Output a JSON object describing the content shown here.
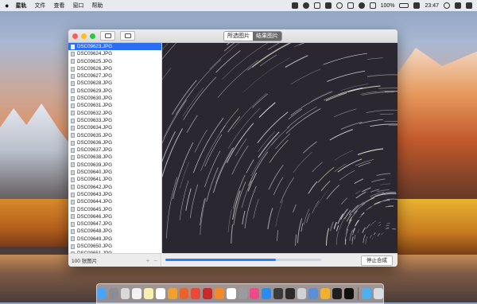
{
  "menubar": {
    "apple": "",
    "items": [
      "星轨",
      "文件",
      "查看",
      "窗口",
      "帮助"
    ],
    "battery": "100%",
    "time": "23:47"
  },
  "toolbar": {
    "seg_selected": "所选图片",
    "seg_result": "结果图片"
  },
  "files": [
    "DSC09623.JPG",
    "DSC09624.JPG",
    "DSC09625.JPG",
    "DSC09626.JPG",
    "DSC09627.JPG",
    "DSC09628.JPG",
    "DSC09629.JPG",
    "DSC09630.JPG",
    "DSC09631.JPG",
    "DSC09632.JPG",
    "DSC09633.JPG",
    "DSC09634.JPG",
    "DSC09635.JPG",
    "DSC09636.JPG",
    "DSC09637.JPG",
    "DSC09638.JPG",
    "DSC09639.JPG",
    "DSC09640.JPG",
    "DSC09641.JPG",
    "DSC09642.JPG",
    "DSC09643.JPG",
    "DSC09644.JPG",
    "DSC09645.JPG",
    "DSC09646.JPG",
    "DSC09647.JPG",
    "DSC09648.JPG",
    "DSC09649.JPG",
    "DSC09650.JPG",
    "DSC09651.JPG",
    "DSC09652.JPG"
  ],
  "selected_file_index": 0,
  "footer": {
    "count_label": "100 张图片",
    "add": "+",
    "remove": "−",
    "stop_button": "停止合成"
  },
  "progress": 0.71,
  "colors": {
    "accent": "#2a6ef5",
    "progress": "#2f7df6",
    "preview_bg": "#2b2730"
  },
  "dock_apps": [
    {
      "name": "finder-icon",
      "color": "#4ba3f5"
    },
    {
      "name": "launchpad-icon",
      "color": "#8c8c94"
    },
    {
      "name": "safari-icon",
      "color": "#d9d9d9"
    },
    {
      "name": "photos-icon",
      "color": "#f2f2f2"
    },
    {
      "name": "notes-icon",
      "color": "#f7f0b0"
    },
    {
      "name": "reminders-icon",
      "color": "#ffffff"
    },
    {
      "name": "pages-icon",
      "color": "#f0a030"
    },
    {
      "name": "firefox-icon",
      "color": "#e8642a"
    },
    {
      "name": "chrome-icon",
      "color": "#e84a3a"
    },
    {
      "name": "photo-booth-icon",
      "color": "#c62a2a"
    },
    {
      "name": "books-icon",
      "color": "#f08a2a"
    },
    {
      "name": "calendar-icon",
      "color": "#ffffff"
    },
    {
      "name": "system-prefs-icon",
      "color": "#9a9aa0"
    },
    {
      "name": "itunes-icon",
      "color": "#ea4c89"
    },
    {
      "name": "appstore-icon",
      "color": "#2d8cf0"
    },
    {
      "name": "quicktime-icon",
      "color": "#3a3a3a"
    },
    {
      "name": "activity-monitor-icon",
      "color": "#2b2b2b"
    },
    {
      "name": "instruments-icon",
      "color": "#cfd3d8"
    },
    {
      "name": "preview-icon",
      "color": "#5d8fd6"
    },
    {
      "name": "sketch-icon",
      "color": "#f0b030"
    },
    {
      "name": "terminal-icon",
      "color": "#1f1f1f"
    },
    {
      "name": "startrails-app-icon",
      "color": "#111111"
    },
    {
      "name": "downloads-folder-icon",
      "color": "#4fb0ef"
    },
    {
      "name": "trash-icon",
      "color": "#d9dde2"
    }
  ]
}
